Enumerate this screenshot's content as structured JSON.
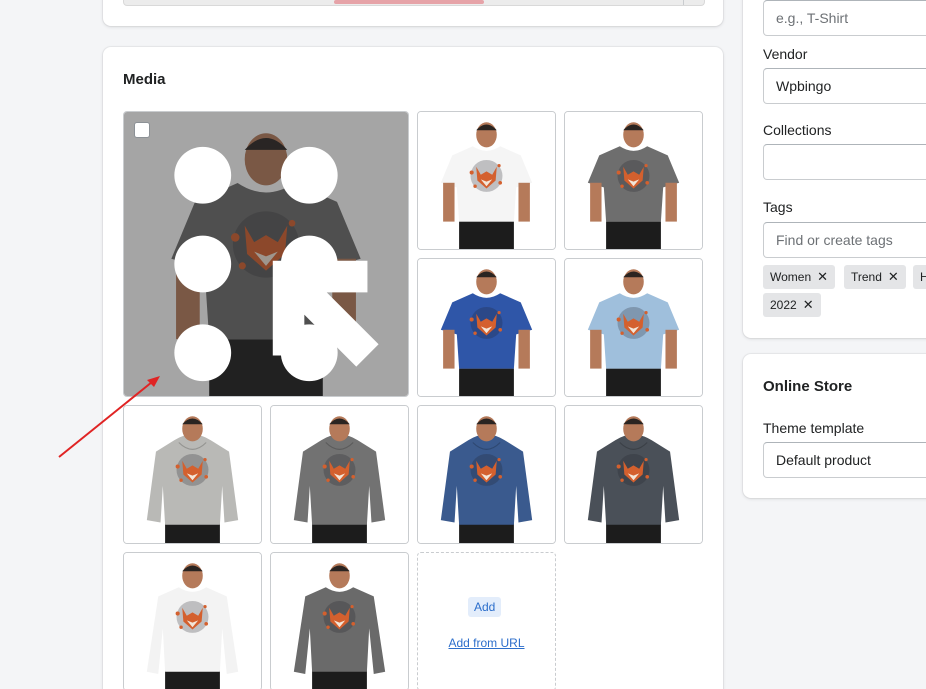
{
  "media": {
    "title": "Media",
    "add_label": "Add",
    "add_url_label": "Add from URL",
    "thumbnails": [
      {
        "kind": "tshirt",
        "color": "#6b6b6b",
        "selected": true
      },
      {
        "kind": "tshirt",
        "color": "#f5f5f5"
      },
      {
        "kind": "tshirt",
        "color": "#6e6e6e"
      },
      {
        "kind": "tshirt",
        "color": "#2f56a8"
      },
      {
        "kind": "tshirt",
        "color": "#9fbfdc"
      },
      {
        "kind": "hoodie",
        "color": "#b9b9b6"
      },
      {
        "kind": "hoodie",
        "color": "#727272"
      },
      {
        "kind": "hoodie",
        "color": "#3a5a8e"
      },
      {
        "kind": "hoodie",
        "color": "#4a5058"
      },
      {
        "kind": "longsleeve",
        "color": "#f3f3f3"
      },
      {
        "kind": "longsleeve",
        "color": "#6a6a6a"
      }
    ]
  },
  "organization": {
    "product_type_placeholder": "e.g., T-Shirt",
    "vendor_label": "Vendor",
    "vendor_value": "Wpbingo",
    "collections_label": "Collections",
    "collections_value": "",
    "tags_label": "Tags",
    "tags_placeholder": "Find or create tags",
    "tags": [
      {
        "label": "Women",
        "x": "✕"
      },
      {
        "label": "Trend",
        "x": "✕"
      },
      {
        "label": "H",
        "x": ""
      },
      {
        "label": "2022",
        "x": "✕"
      }
    ]
  },
  "online_store": {
    "title": "Online Store",
    "theme_label": "Theme template",
    "theme_value": "Default product"
  },
  "colors": {
    "accent": "#2c6ecb",
    "arrow": "#e02424",
    "fox_orange": "#d4602e"
  }
}
